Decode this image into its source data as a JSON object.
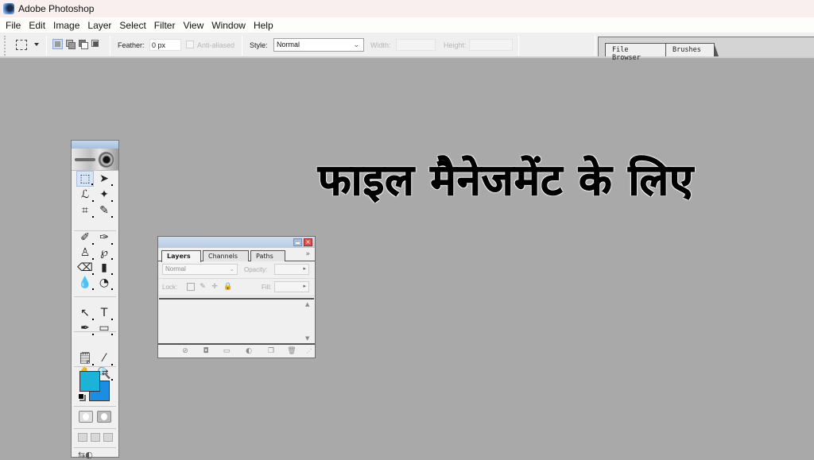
{
  "window": {
    "title": "Adobe Photoshop"
  },
  "menu": [
    "File",
    "Edit",
    "Image",
    "Layer",
    "Select",
    "Filter",
    "View",
    "Window",
    "Help"
  ],
  "options_bar": {
    "feather_label": "Feather:",
    "feather_value": "0 px",
    "antialiased_label": "Anti-aliased",
    "style_label": "Style:",
    "style_value": "Normal",
    "width_label": "Width:",
    "height_label": "Height:"
  },
  "palette_well": {
    "tabs": [
      "File Browser",
      "Brushes"
    ]
  },
  "toolbox": {
    "tools": [
      {
        "name": "rectangular-marquee-tool",
        "glyph": "⬚",
        "active": true
      },
      {
        "name": "move-tool",
        "glyph": "➤"
      },
      {
        "name": "lasso-tool",
        "glyph": "ℒ"
      },
      {
        "name": "magic-wand-tool",
        "glyph": "✦"
      },
      {
        "name": "crop-tool",
        "glyph": "⌗"
      },
      {
        "name": "slice-tool",
        "glyph": "✎"
      },
      {
        "name": "healing-brush-tool",
        "glyph": "✐"
      },
      {
        "name": "brush-tool",
        "glyph": "✑"
      },
      {
        "name": "clone-stamp-tool",
        "glyph": "♙"
      },
      {
        "name": "history-brush-tool",
        "glyph": "℘"
      },
      {
        "name": "eraser-tool",
        "glyph": "⌫"
      },
      {
        "name": "gradient-tool",
        "glyph": "▮"
      },
      {
        "name": "blur-tool",
        "glyph": "💧"
      },
      {
        "name": "dodge-tool",
        "glyph": "◔"
      },
      {
        "name": "path-selection-tool",
        "glyph": "↖"
      },
      {
        "name": "type-tool",
        "glyph": "T"
      },
      {
        "name": "pen-tool",
        "glyph": "✒"
      },
      {
        "name": "rectangle-tool",
        "glyph": "▭"
      },
      {
        "name": "notes-tool",
        "glyph": "🗒"
      },
      {
        "name": "eyedropper-tool",
        "glyph": "⁄"
      },
      {
        "name": "hand-tool",
        "glyph": "✋"
      },
      {
        "name": "zoom-tool",
        "glyph": "🔍"
      }
    ],
    "foreground_color": "#1cb3d9",
    "background_color": "#1b8de4"
  },
  "layers_panel": {
    "tabs": [
      "Layers",
      "Channels",
      "Paths"
    ],
    "active_tab": "Layers",
    "more": "»",
    "blend_mode": "Normal",
    "opacity_label": "Opacity:",
    "lock_label": "Lock:",
    "fill_label": "Fill:"
  },
  "headline": "फाइल मैनेजमेंट के लिए"
}
